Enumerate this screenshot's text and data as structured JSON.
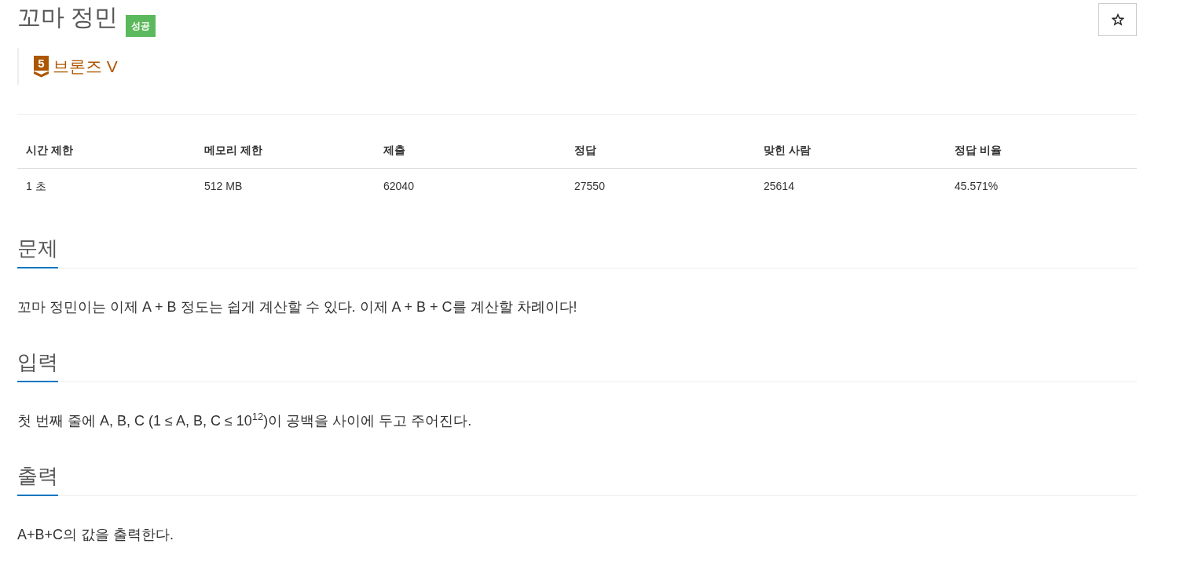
{
  "problem": {
    "title": "꼬마 정민",
    "result_label": "성공"
  },
  "tier": {
    "number": "5",
    "name": "브론즈 V"
  },
  "stats": {
    "columns": [
      "시간 제한",
      "메모리 제한",
      "제출",
      "정답",
      "맞힌 사람",
      "정답 비율"
    ],
    "rows": [
      [
        "1 초",
        "512 MB",
        "62040",
        "27550",
        "25614",
        "45.571%"
      ]
    ]
  },
  "sections": [
    {
      "heading": "문제",
      "text": "꼬마 정민이는 이제 A + B 정도는 쉽게 계산할 수 있다. 이제 A + B + C를 계산할 차례이다!"
    },
    {
      "heading": "입력",
      "text": "첫 번째 줄에 A, B, C (1 ≤ A, B, C ≤ 10$^{12}$)이 공백을 사이에 두고 주어진다."
    },
    {
      "heading": "출력",
      "text": "A+B+C의 값을 출력한다."
    }
  ]
}
